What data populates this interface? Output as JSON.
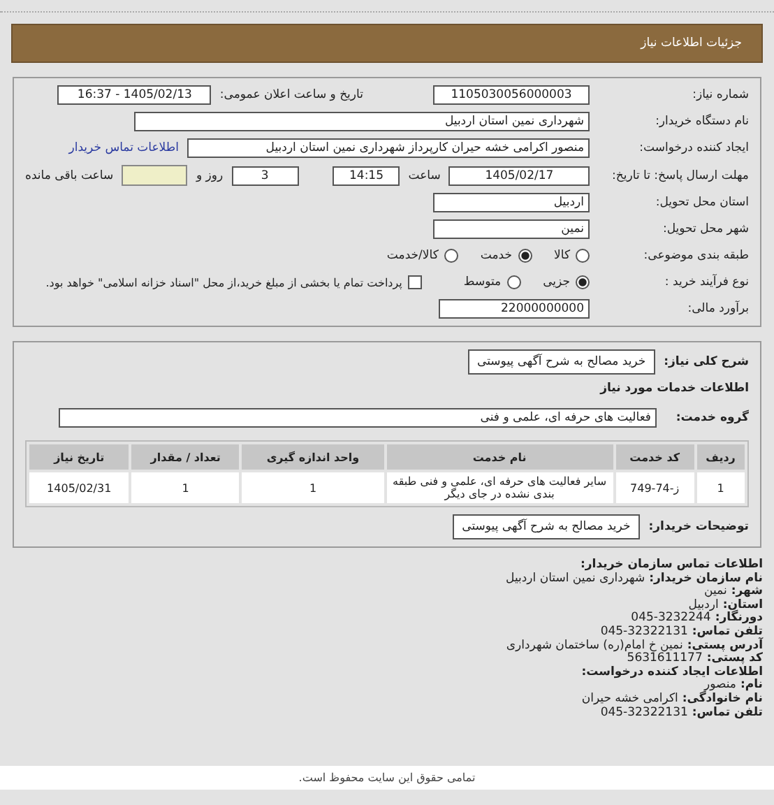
{
  "header": {
    "title": "جزئیات اطلاعات نیاز"
  },
  "details": {
    "need_number": {
      "label": "شماره نیاز:",
      "value": "1105030056000003"
    },
    "announce": {
      "label": "تاریخ و ساعت اعلان عمومی:",
      "value": "1405/02/13 - 16:37"
    },
    "buyer": {
      "label": "نام دستگاه خریدار:",
      "value": "شهرداری نمین استان اردبیل"
    },
    "creator": {
      "label": "ایجاد کننده درخواست:",
      "value": "منصور اکرامی خشه حیران کارپرداز شهرداری نمین استان اردبیل",
      "link": "اطلاعات تماس خریدار"
    },
    "deadline": {
      "label": "مهلت ارسال پاسخ: تا تاریخ:",
      "date": "1405/02/17",
      "time_label": "ساعت",
      "time": "14:15",
      "days": "3",
      "days_label": "روز و",
      "remaining_label": "ساعت باقی مانده"
    },
    "province": {
      "label": "استان محل تحویل:",
      "value": "اردبیل"
    },
    "city": {
      "label": "شهر محل تحویل:",
      "value": "نمین"
    },
    "category": {
      "label": "طبقه بندی موضوعی:",
      "options": [
        {
          "label": "کالا",
          "selected": false
        },
        {
          "label": "خدمت",
          "selected": true
        },
        {
          "label": "کالا/خدمت",
          "selected": false
        }
      ]
    },
    "process": {
      "label": "نوع فرآیند خرید :",
      "options": [
        {
          "label": "جزیی",
          "selected": true
        },
        {
          "label": "متوسط",
          "selected": false
        }
      ],
      "payment": {
        "label": "پرداخت تمام یا بخشی از مبلغ خرید،از محل \"اسناد خزانه اسلامی\" خواهد بود.",
        "checked": false
      }
    },
    "estimate": {
      "label": "برآورد مالی:",
      "value": "22000000000"
    }
  },
  "services": {
    "summary": {
      "label": "شرح کلی نیاز:",
      "value": "خرید مصالح به شرح آگهی پیوستی"
    },
    "section_title": "اطلاعات خدمات مورد نیاز",
    "group": {
      "label": "گروه خدمت:",
      "value": "فعالیت های حرفه ای، علمی و فنی"
    },
    "table": {
      "columns": [
        "ردیف",
        "کد خدمت",
        "نام خدمت",
        "واحد اندازه گیری",
        "تعداد / مقدار",
        "تاریخ نیاز"
      ],
      "rows": [
        [
          "1",
          "ز-74-749",
          "سایر فعالیت های حرفه ای، علمی و فنی طبقه بندی نشده در جای دیگر",
          "1",
          "1",
          "1405/02/31"
        ]
      ]
    },
    "buyer_notes": {
      "label": "توضیحات خریدار:",
      "value": "خرید مصالح به شرح آگهی پیوستی"
    }
  },
  "contact": {
    "title": "اطلاعات تماس سازمان خریدار:",
    "lines": [
      {
        "label": "نام سازمان خریدار:",
        "value": "شهرداری نمین استان اردبیل"
      },
      {
        "label": "شهر:",
        "value": "نمین"
      },
      {
        "label": "استان:",
        "value": "اردبیل"
      },
      {
        "label": "دورنگار:",
        "value": "045-3232244"
      },
      {
        "label": "تلفن تماس:",
        "value": "045-32322131"
      },
      {
        "label": "آدرس پستی:",
        "value": "نمین خ امام(ره) ساختمان شهرداری"
      },
      {
        "label": "کد پستی:",
        "value": "5631611177"
      }
    ],
    "creator_title": "اطلاعات ایجاد کننده درخواست:",
    "creator_lines": [
      {
        "label": "نام:",
        "value": "منصور"
      },
      {
        "label": "نام خانوادگی:",
        "value": "اکرامی خشه حیران"
      },
      {
        "label": "تلفن تماس:",
        "value": "045-32322131"
      }
    ]
  },
  "footer": {
    "text": "تمامی حقوق این سایت محفوظ است."
  }
}
